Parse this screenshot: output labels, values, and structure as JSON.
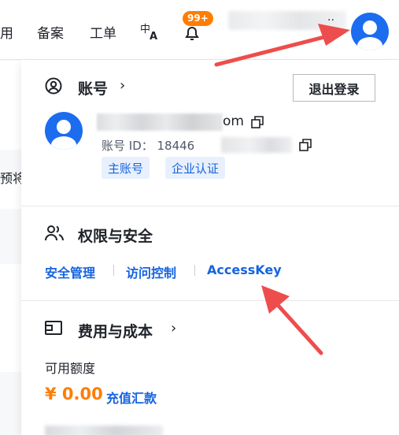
{
  "topnav": {
    "items": [
      "用",
      "备案",
      "工单"
    ],
    "notification_badge": "99+"
  },
  "left_strip": {
    "partial_text": "预将"
  },
  "account": {
    "title": "账号",
    "logout_label": "退出登录",
    "email_suffix": "om",
    "id_label": "账号 ID： 18446",
    "tags": [
      "主账号",
      "企业认证"
    ]
  },
  "security": {
    "title": "权限与安全",
    "links": [
      "安全管理",
      "访问控制",
      "AccessKey"
    ]
  },
  "billing": {
    "title": "费用与成本",
    "credit_label": "可用额度",
    "credit_value": "¥ 0.00",
    "recharge_label": "充值汇款"
  },
  "colors": {
    "accent_blue": "#1664e0",
    "avatar_blue": "#1c6cf0",
    "orange": "#ff7d00",
    "arrow_red": "#ee4d4d"
  },
  "icons": [
    "translate-icon",
    "bell-icon",
    "user-circle-icon",
    "users-icon",
    "wallet-icon",
    "copy-icon",
    "chevron-right-icon"
  ]
}
